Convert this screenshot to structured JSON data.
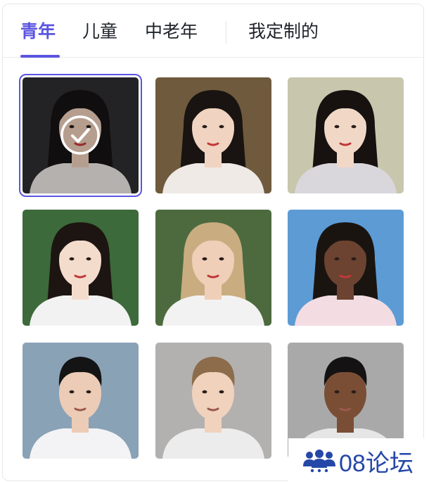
{
  "tabs": [
    {
      "label": "青年",
      "active": true
    },
    {
      "label": "儿童",
      "active": false
    },
    {
      "label": "中老年",
      "active": false
    },
    {
      "label": "我定制的",
      "active": false
    }
  ],
  "avatars": [
    {
      "name": "young-woman-long-black-hair",
      "selected": true,
      "bg": "#2e2e30",
      "skin": "#e9cbb8",
      "hair": "#151312",
      "top": "#e7e3df"
    },
    {
      "name": "young-woman-short-bob",
      "selected": false,
      "bg": "#6f5a3d",
      "skin": "#f0d3c0",
      "hair": "#191411",
      "top": "#efeae6"
    },
    {
      "name": "young-woman-braids",
      "selected": false,
      "bg": "#c9c6ae",
      "skin": "#f1d8c6",
      "hair": "#17120f",
      "top": "#d9d7dc"
    },
    {
      "name": "young-woman-red-lips",
      "selected": false,
      "bg": "#3c6a3a",
      "skin": "#f4dccd",
      "hair": "#1d1512",
      "top": "#f2f2f2"
    },
    {
      "name": "young-woman-blonde-bob",
      "selected": false,
      "bg": "#4d6a3f",
      "skin": "#f0cfb8",
      "hair": "#c9ad80",
      "top": "#f2f2f2"
    },
    {
      "name": "young-woman-dark-braids",
      "selected": false,
      "bg": "#5d9bd5",
      "skin": "#6b4330",
      "hair": "#1a1411",
      "top": "#f3dde3"
    },
    {
      "name": "young-man-short-hair",
      "selected": false,
      "bg": "#8aa2b6",
      "skin": "#ecccb6",
      "hair": "#141414",
      "top": "#f3f3f5"
    },
    {
      "name": "young-man-blonde",
      "selected": false,
      "bg": "#b3b1af",
      "skin": "#f0d2bd",
      "hair": "#8c6c4a",
      "top": "#ececec"
    },
    {
      "name": "young-man-dark-skin",
      "selected": false,
      "bg": "#a9a9a9",
      "skin": "#7a4e35",
      "hair": "#141212",
      "top": "#e6e6e6"
    }
  ],
  "watermark": {
    "text": "08论坛",
    "color": "#2547a8"
  },
  "accent": "#5b55e0"
}
